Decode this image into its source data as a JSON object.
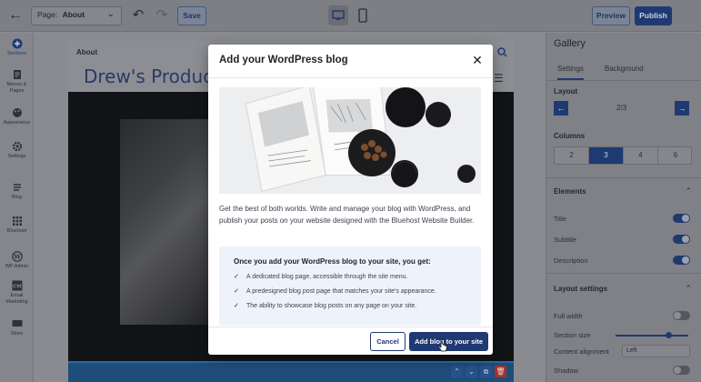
{
  "topbar": {
    "page_prefix": "Page:",
    "page_value": "About",
    "save_label": "Save",
    "preview_label": "Preview",
    "publish_label": "Publish"
  },
  "sidebar": {
    "items": [
      {
        "label": "Sections",
        "icon": "plus-circle-icon"
      },
      {
        "label": "Menus & Pages",
        "icon": "document-icon"
      },
      {
        "label": "Appearance",
        "icon": "palette-icon"
      },
      {
        "label": "Settings",
        "icon": "gear-icon"
      },
      {
        "label": "Blog",
        "icon": "blog-icon"
      },
      {
        "label": "Bluehost",
        "icon": "grid-icon"
      },
      {
        "label": "WP Admin",
        "icon": "wordpress-icon"
      },
      {
        "label": "Email Marketing",
        "icon": "cm-icon"
      },
      {
        "label": "Store",
        "icon": "store-icon"
      }
    ]
  },
  "site": {
    "nav_label": "About",
    "title": "Drew's Product C"
  },
  "panel": {
    "title": "Gallery",
    "tabs": [
      "Settings",
      "Background"
    ],
    "layout_label": "Layout",
    "layout_value": "2/3",
    "columns_label": "Columns",
    "columns": [
      "2",
      "3",
      "4",
      "6"
    ],
    "columns_selected": "3",
    "elements_label": "Elements",
    "elements": [
      {
        "label": "Title",
        "on": true
      },
      {
        "label": "Subtitle",
        "on": true
      },
      {
        "label": "Description",
        "on": true
      }
    ],
    "layout_settings_label": "Layout settings",
    "full_width_label": "Full width",
    "full_width_on": false,
    "section_size_label": "Section size",
    "section_size_level": 0.7,
    "content_alignment_label": "Content alignment",
    "content_alignment_value": "Left",
    "shadow_label": "Shadow",
    "shadow_on": false
  },
  "modal": {
    "title": "Add your WordPress blog",
    "description": "Get the best of both worlds. Write and manage your blog with WordPress, and publish your posts on your website designed with the Bluehost Website Builder.",
    "box_title": "Once you add your WordPress blog to your site, you get:",
    "benefits": [
      "A dedicated blog page, accessible through the site menu.",
      "A predesigned blog post page that matches your site's appearance.",
      "The ability to showcase blog posts on any page on your site."
    ],
    "cancel_label": "Cancel",
    "add_label": "Add blog to your site"
  },
  "colors": {
    "accent": "#1f3a72",
    "benefit_box": "#eef3fb",
    "delete": "#a0332e"
  }
}
